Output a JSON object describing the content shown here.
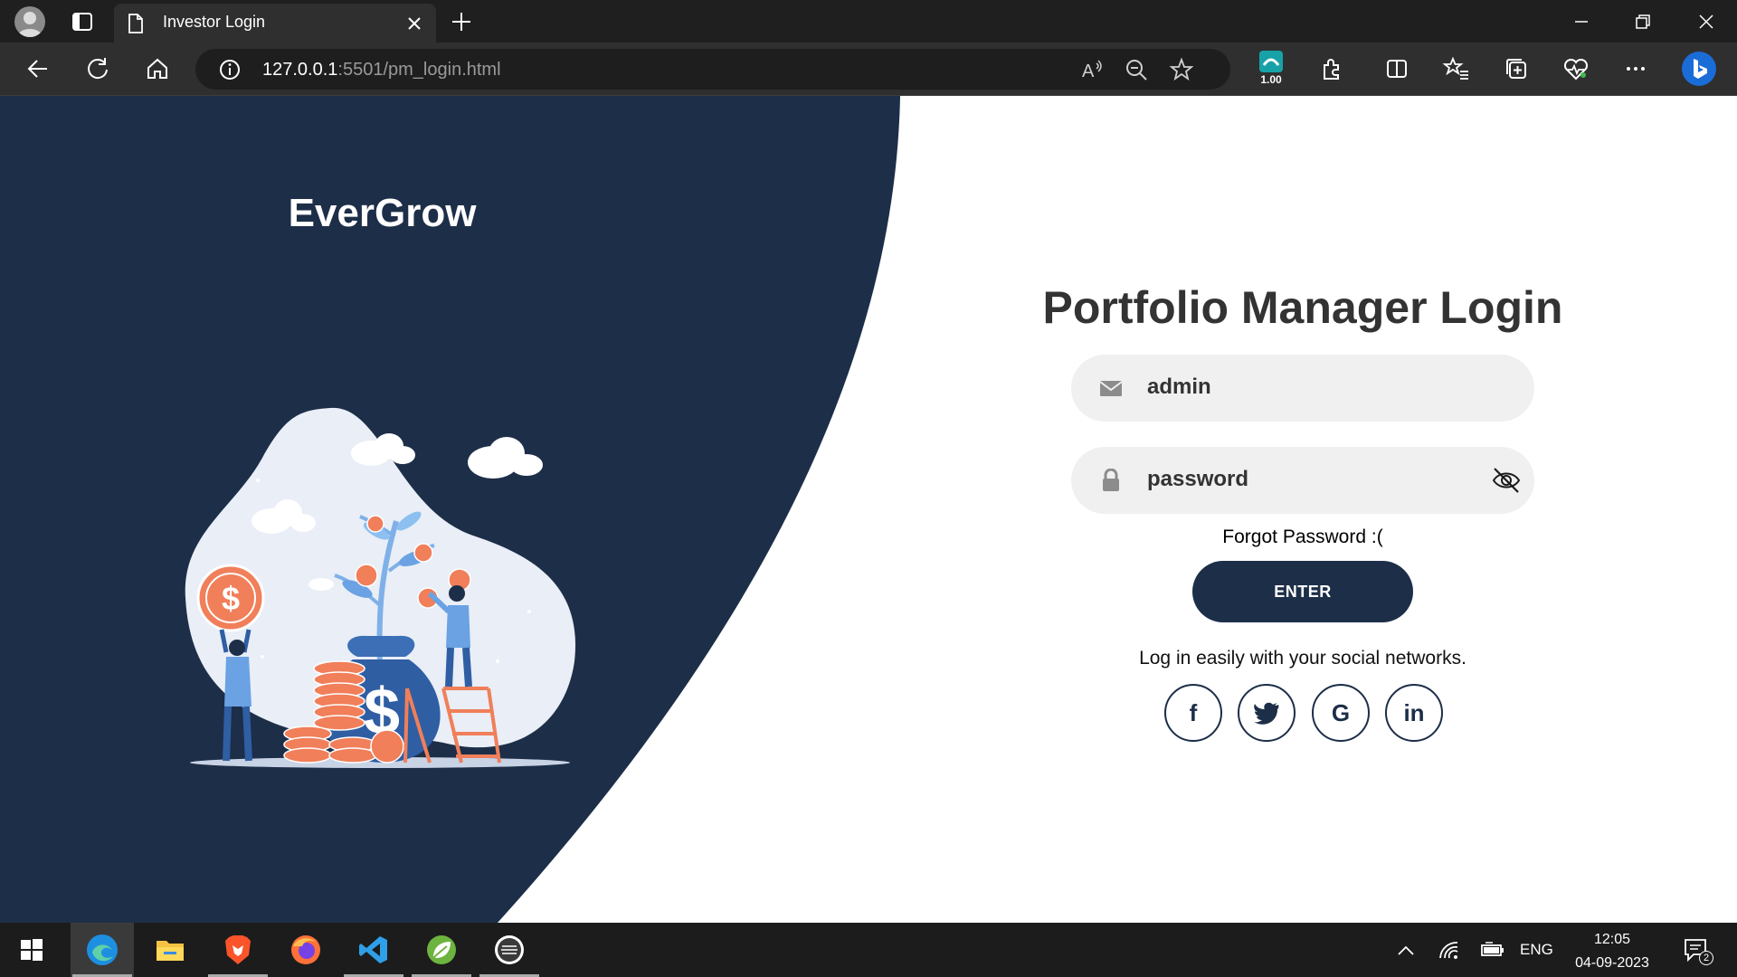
{
  "browser": {
    "tab_title": "Investor Login",
    "url_host": "127.0.0.1",
    "url_rest": ":5501/pm_login.html",
    "extension_badge": "1.00"
  },
  "page": {
    "brand": "EverGrow",
    "login": {
      "title": "Portfolio Manager Login",
      "username_value": "admin",
      "password_value": "password",
      "forgot_label": "Forgot Password :(",
      "enter_label": "ENTER",
      "social_prompt": "Log in easily with your social networks.",
      "social": [
        {
          "label": "f",
          "icon": "facebook-icon"
        },
        {
          "label": "t",
          "icon": "twitter-icon"
        },
        {
          "label": "G",
          "icon": "google-icon"
        },
        {
          "label": "in",
          "icon": "linkedin-icon"
        }
      ]
    }
  },
  "taskbar": {
    "apps": [
      "start-button",
      "edge",
      "file-explorer",
      "brave",
      "firefox",
      "vscode",
      "spring-tool-suite",
      "eclipse"
    ],
    "language": "ENG",
    "time": "12:05",
    "date": "04-09-2023",
    "notification_count": "2"
  },
  "colors": {
    "navy": "#1d2e48",
    "field_bg": "#f0f0f0",
    "chrome_dark": "#1f1f1f",
    "accent_orange": "#f07f5a"
  }
}
